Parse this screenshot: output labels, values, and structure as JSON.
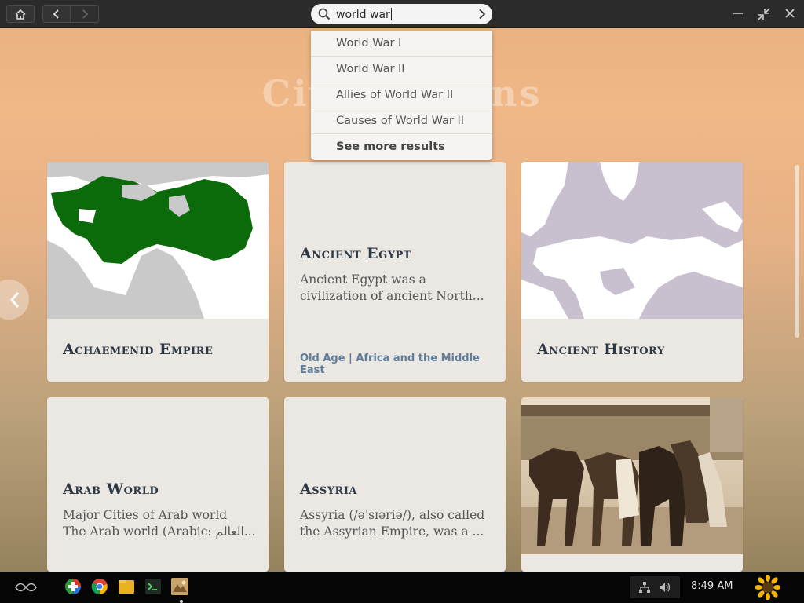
{
  "window": {
    "search": {
      "value": "world war",
      "placeholder": "Search"
    },
    "nav": {
      "home_icon": "home-icon",
      "back_icon": "chevron-left-icon",
      "forward_icon": "chevron-right-icon"
    },
    "controls": [
      "minimize-icon",
      "unmaximize-icon",
      "close-icon"
    ]
  },
  "dropdown": {
    "items": [
      "World War I",
      "World War II",
      "Allies of World War II",
      "Causes of World War II",
      "See more results"
    ]
  },
  "background_title": "Civilizations",
  "cards": [
    {
      "title": "Achaemenid Empire",
      "image": "map-achaemenid"
    },
    {
      "title": "Ancient Egypt",
      "desc_line1": "Ancient Egypt was a",
      "desc_line2": "civilization of ancient North...",
      "meta": "Old Age | Africa and the Middle East"
    },
    {
      "title": "Ancient History",
      "image": "map-europe"
    },
    {
      "title": "Arab World",
      "desc_line1": "Major Cities of Arab world",
      "desc_line2": "The Arab world (Arabic: العالم..."
    },
    {
      "title": "Assyria",
      "desc_line1": "Assyria (/əˈsɪəriə/), also called",
      "desc_line2": "the Assyrian Empire, was a ..."
    },
    {
      "title": "",
      "image": "photo-camels"
    }
  ],
  "taskbar": {
    "time": "8:49 AM",
    "apps": [
      "app-store-icon",
      "chrome-icon",
      "files-icon",
      "terminal-icon",
      "encyclopedia-icon"
    ],
    "tray": [
      "network-icon",
      "volume-icon"
    ]
  },
  "colors": {
    "topbar": "#2b2b2b",
    "card_bg": "#ebe8e4",
    "card_title": "#2d3845",
    "meta_link": "#5f7d9b",
    "map_green": "#0b6b0b"
  }
}
